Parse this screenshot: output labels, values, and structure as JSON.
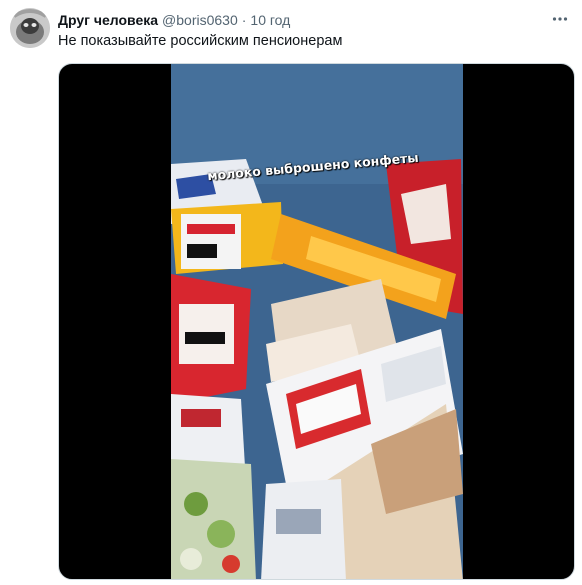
{
  "tweet": {
    "author_name": "Друг человека",
    "handle": "@boris0630",
    "separator": "·",
    "time": "10 год",
    "text": "Не показывайте российским пенсионерам"
  },
  "media": {
    "caption": "молоко выброшено конфеты"
  },
  "icons": {
    "more": "more-horizontal-icon"
  }
}
